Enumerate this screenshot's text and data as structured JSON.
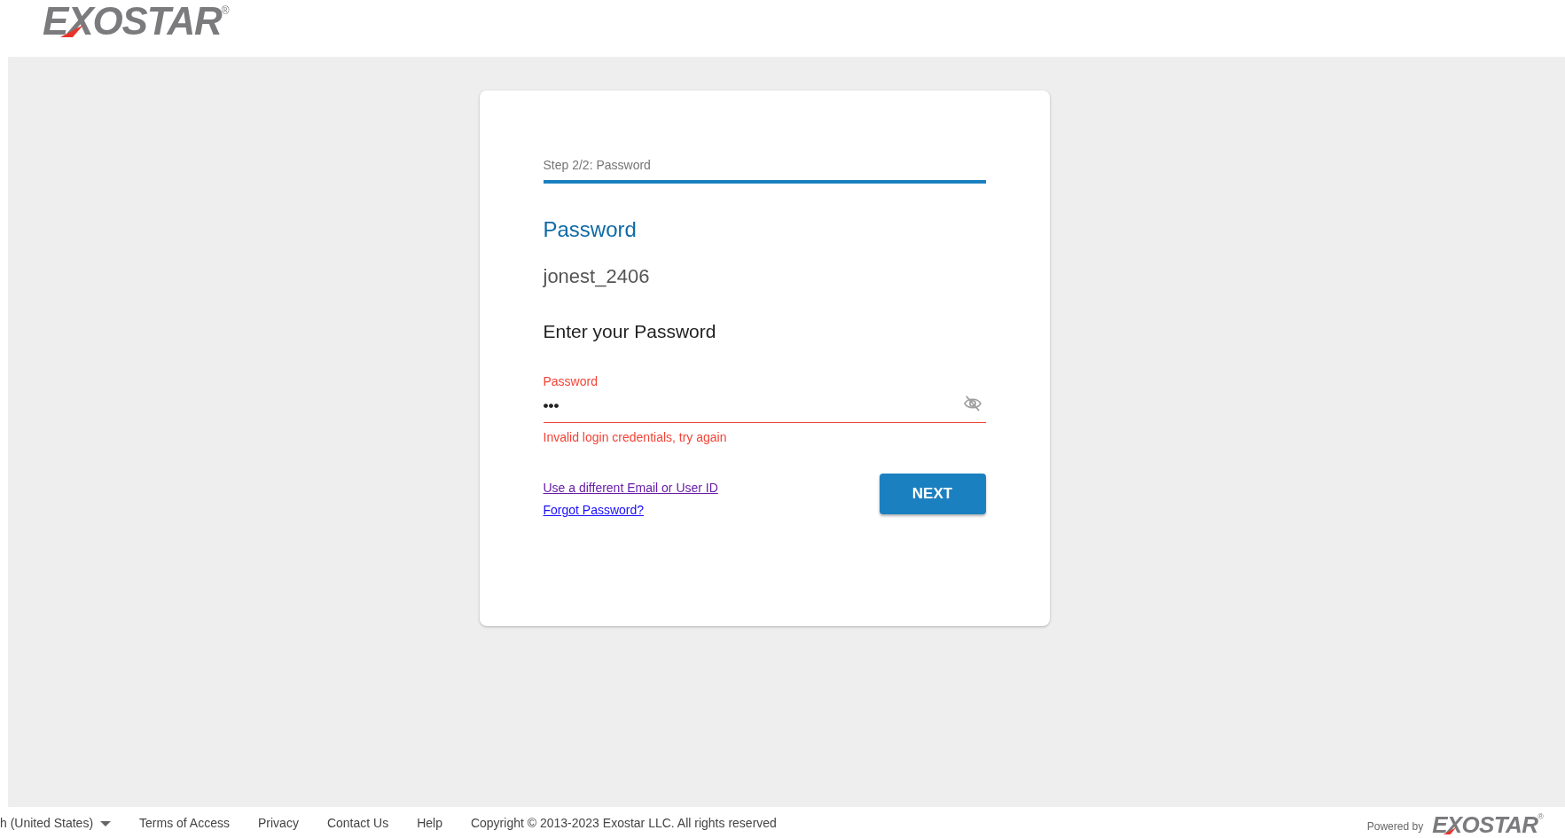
{
  "header": {
    "logo": {
      "text": "EXOSTAR",
      "mark": "®"
    }
  },
  "card": {
    "step": {
      "label": "Step 2/2: Password",
      "level": 1
    },
    "title": "Password",
    "username": "jonest_2406",
    "prompt": "Enter your Password",
    "password_field": {
      "label": "Password",
      "value": "•••",
      "error": true,
      "error_text": "Invalid login credentials, try again"
    },
    "links": [
      {
        "label": "Use a different Email or User ID",
        "visited": true
      },
      {
        "label": "Forgot Password?",
        "visited": false
      }
    ],
    "next_button": "NEXT"
  },
  "footer": {
    "language": "h (United States)",
    "links": [
      "Terms of Access",
      "Privacy",
      "Contact Us",
      "Help"
    ],
    "copyright": "Copyright © 2013-2023 Exostar LLC. All rights reserved",
    "powered_by": "Powered by",
    "logo": {
      "text": "EXOSTAR",
      "mark": "®"
    }
  }
}
